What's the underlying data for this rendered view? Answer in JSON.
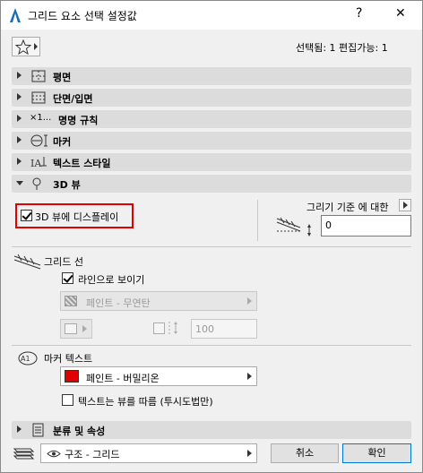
{
  "window": {
    "title": "그리드 요소 선택 설정값",
    "help": "?",
    "close": "✕"
  },
  "header": {
    "selection_info": "선택됨: 1 편집가능: 1"
  },
  "sections": [
    {
      "label": "평면",
      "expanded": false,
      "icon": "floorplan-icon"
    },
    {
      "label": "단면/입면",
      "expanded": false,
      "icon": "section-elevation-icon"
    },
    {
      "label": "명명 규칙",
      "expanded": false,
      "icon": "naming-icon",
      "icon_text": "×1..."
    },
    {
      "label": "마커",
      "expanded": false,
      "icon": "marker-icon"
    },
    {
      "label": "텍스트 스타일",
      "expanded": false,
      "icon": "text-style-icon"
    },
    {
      "label": "3D 뷰",
      "expanded": true,
      "icon": "3d-view-icon"
    }
  ],
  "view3d": {
    "display_label": "3D 뷰에 디스플레이",
    "display_checked": true,
    "draw_by_label": "그리기 기준 에 대한",
    "height_value": "0"
  },
  "grid_line": {
    "label": "그리드 선",
    "show_as_line_label": "라인으로 보이기",
    "show_as_line_checked": true,
    "paint_value": "페인트 - 무연탄",
    "size_value": "100"
  },
  "marker_text": {
    "label": "마커 텍스트",
    "paint_value": "페인트 - 버밀리온",
    "paint_color": "#e00000",
    "follow_view_label": "텍스트는 뷰를 따름 (투시도법만)",
    "follow_view_checked": false
  },
  "classification": {
    "label": "분류 및 속성",
    "expanded": false
  },
  "footer": {
    "layer_value": "구조 - 그리드",
    "cancel_label": "취소",
    "ok_label": "확인"
  },
  "colors": {
    "highlight": "#e00000",
    "section_bg": "#dcdcdc",
    "accent": "#0078d7"
  }
}
